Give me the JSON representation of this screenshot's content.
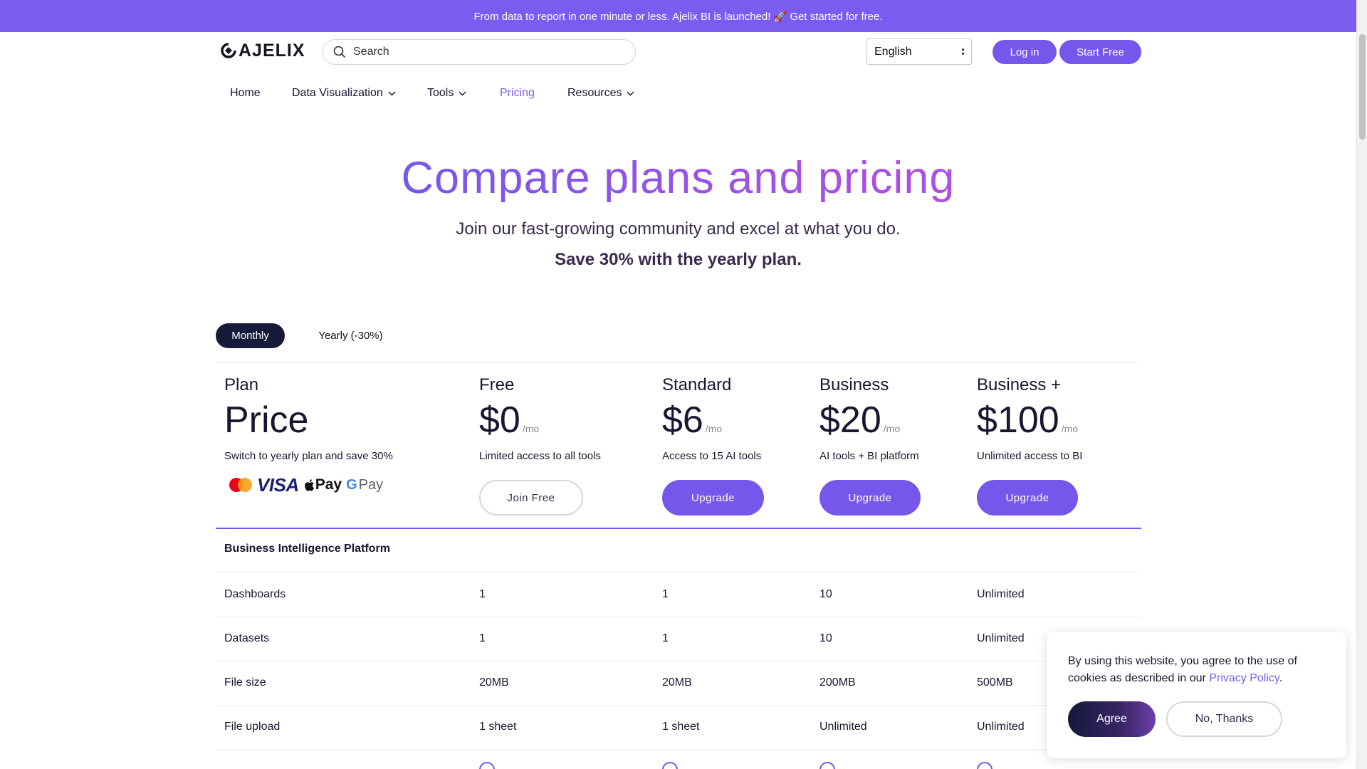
{
  "announcement": "From data to report in one minute or less. Ajelix BI is launched! 🚀 Get started for free.",
  "header": {
    "logo_text": "AJELIX",
    "search_placeholder": "Search",
    "language": "English",
    "login_label": "Log in",
    "start_free_label": "Start Free"
  },
  "nav": {
    "items": [
      {
        "label": "Home",
        "has_dropdown": false
      },
      {
        "label": "Data Visualization",
        "has_dropdown": true
      },
      {
        "label": "Tools",
        "has_dropdown": true
      },
      {
        "label": "Pricing",
        "has_dropdown": false,
        "active": true
      },
      {
        "label": "Resources",
        "has_dropdown": true
      }
    ]
  },
  "hero": {
    "title": "Compare plans and pricing",
    "subtitle": "Join our fast-growing community and excel at what you do.",
    "save_text": "Save 30% with the yearly plan."
  },
  "billing_toggle": {
    "monthly": "Monthly",
    "yearly": "Yearly (-30%)",
    "selected": "monthly"
  },
  "plans_header": {
    "label_name": "Plan",
    "label_price": "Price",
    "label_desc": "Switch to yearly plan and save 30%",
    "payment_methods": [
      "mastercard",
      "VISA",
      "Pay",
      "Pay"
    ]
  },
  "plans": [
    {
      "name": "Free",
      "price": "$0",
      "unit": "/mo",
      "desc": "Limited access to all tools",
      "button": "Join Free",
      "button_style": "outline"
    },
    {
      "name": "Standard",
      "price": "$6",
      "unit": "/mo",
      "desc": "Access to 15 AI tools",
      "button": "Upgrade",
      "button_style": "solid"
    },
    {
      "name": "Business",
      "price": "$20",
      "unit": "/mo",
      "desc": "AI tools + BI platform",
      "button": "Upgrade",
      "button_style": "solid"
    },
    {
      "name": "Business +",
      "price": "$100",
      "unit": "/mo",
      "desc": "Unlimited access to BI",
      "button": "Upgrade",
      "button_style": "solid"
    }
  ],
  "features": {
    "section_title": "Business Intelligence Platform",
    "rows": [
      {
        "label": "Dashboards",
        "values": [
          "1",
          "1",
          "10",
          "Unlimited"
        ]
      },
      {
        "label": "Datasets",
        "values": [
          "1",
          "1",
          "10",
          "Unlimited"
        ]
      },
      {
        "label": "File size",
        "values": [
          "20MB",
          "20MB",
          "200MB",
          "500MB"
        ]
      },
      {
        "label": "File upload",
        "values": [
          "1 sheet",
          "1 sheet",
          "Unlimited",
          "Unlimited"
        ]
      }
    ]
  },
  "cookie": {
    "text": "By using this website, you agree to the use of cookies as described in our ",
    "link": "Privacy Policy",
    "suffix": ".",
    "agree": "Agree",
    "decline": "No, Thanks"
  },
  "colors": {
    "accent": "#7657ec",
    "announce_bg": "#7b5cf0",
    "dark": "#161b3a"
  }
}
